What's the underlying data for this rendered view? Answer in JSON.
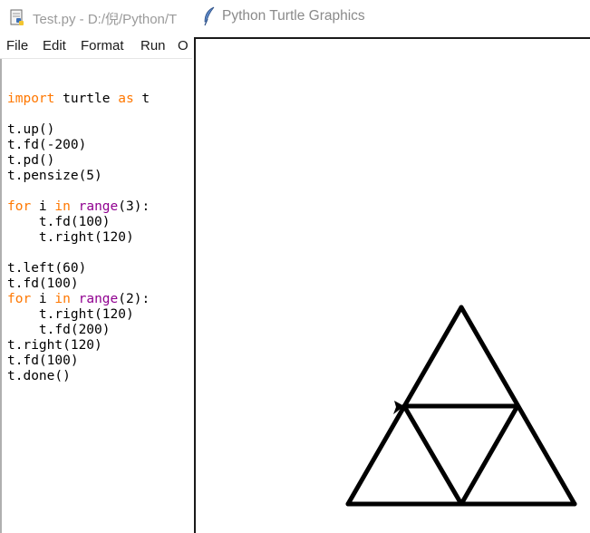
{
  "idle": {
    "title": "Test.py - D:/倪/Python/T",
    "menu": [
      "File",
      "Edit",
      "Format",
      "Run",
      "O"
    ],
    "code": [
      [],
      [
        [
          "kw",
          "import"
        ],
        [
          "tx",
          " turtle "
        ],
        [
          "kw",
          "as"
        ],
        [
          "tx",
          " t"
        ]
      ],
      [],
      [
        [
          "tx",
          "t.up()"
        ]
      ],
      [
        [
          "tx",
          "t.fd(-200)"
        ]
      ],
      [
        [
          "tx",
          "t.pd()"
        ]
      ],
      [
        [
          "tx",
          "t.pensize(5)"
        ]
      ],
      [],
      [
        [
          "kw",
          "for"
        ],
        [
          "tx",
          " i "
        ],
        [
          "kw",
          "in"
        ],
        [
          "tx",
          " "
        ],
        [
          "bi",
          "range"
        ],
        [
          "tx",
          "(3):"
        ]
      ],
      [
        [
          "tx",
          "    t.fd(100)"
        ]
      ],
      [
        [
          "tx",
          "    t.right(120)"
        ]
      ],
      [],
      [
        [
          "tx",
          "t.left(60)"
        ]
      ],
      [
        [
          "tx",
          "t.fd(100)"
        ]
      ],
      [
        [
          "kw",
          "for"
        ],
        [
          "tx",
          " i "
        ],
        [
          "kw",
          "in"
        ],
        [
          "tx",
          " "
        ],
        [
          "bi",
          "range"
        ],
        [
          "tx",
          "(2):"
        ]
      ],
      [
        [
          "tx",
          "    t.right(120)"
        ]
      ],
      [
        [
          "tx",
          "    t.fd(200)"
        ]
      ],
      [
        [
          "tx",
          "t.right(120)"
        ]
      ],
      [
        [
          "tx",
          "t.fd(100)"
        ]
      ],
      [
        [
          "tx",
          "t.done()"
        ]
      ]
    ],
    "colors": {
      "keyword": "#ff7700",
      "builtin": "#900090",
      "text": "#000000"
    }
  },
  "turtle": {
    "title": "Python Turtle Graphics",
    "pen_color": "#000000",
    "pen_size": 5,
    "icon": "feather-icon"
  }
}
